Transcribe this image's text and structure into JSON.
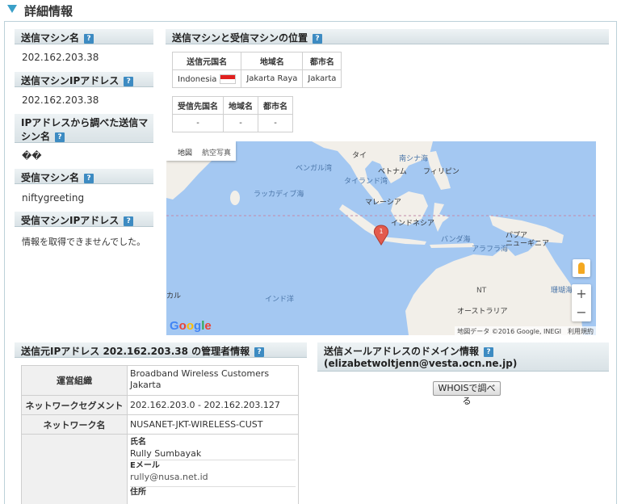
{
  "page_title": "詳細情報",
  "help_glyph": "?",
  "sender": {
    "name_header": "送信マシン名",
    "name_value": "202.162.203.38",
    "ip_header": "送信マシンIPアドレス",
    "ip_value": "202.162.203.38",
    "lookup_header": "IPアドレスから調べた送信マシン名",
    "lookup_value": "��"
  },
  "receiver": {
    "name_header": "受信マシン名",
    "name_value": "niftygreeting",
    "ip_header": "受信マシンIPアドレス",
    "ip_value": "情報を取得できませんでした。"
  },
  "location": {
    "header": "送信マシンと受信マシンの位置",
    "sender_table": {
      "headers": [
        "送信元国名",
        "地域名",
        "都市名"
      ],
      "country": "Indonesia",
      "region": "Jakarta Raya",
      "city": "Jakarta"
    },
    "receiver_table": {
      "headers": [
        "受信先国名",
        "地域名",
        "都市名"
      ],
      "values": [
        "-",
        "-",
        "-"
      ]
    }
  },
  "map": {
    "tab_map": "地図",
    "tab_satellite": "航空写真",
    "marker_label": "1",
    "logo": "Google",
    "attribution": "地図データ ©2016 Google, INEGI　利用規約",
    "zoom_in": "+",
    "zoom_out": "−",
    "labels": {
      "thai": "タイ",
      "south_china_sea": "南シナ海",
      "bengal": "ベンガル湾",
      "vietnam": "ベトナム",
      "philippines": "フィリピン",
      "gulf_thailand": "タイランド湾",
      "laccadive": "ラッカディブ海",
      "malaysia": "マレーシア",
      "indonesia": "インドネシア",
      "banda": "バンダ海",
      "arafura": "アラフラ海",
      "papua": "パプア\nニューギニア",
      "nt": "NT",
      "indian_ocean": "インド洋",
      "kal": "カル",
      "australia": "オーストラリア",
      "coral": "珊瑚海"
    }
  },
  "admin": {
    "header": "送信元IPアドレス 202.162.203.38 の管理者情報",
    "rows": [
      {
        "label": "運営組織",
        "value1": "Broadband Wireless Customers",
        "value2": "Jakarta"
      },
      {
        "label": "ネットワークセグメント",
        "value1": "202.162.203.0 - 202.162.203.127"
      },
      {
        "label": "ネットワーク名",
        "value1": "NUSANET-JKT-WIRELESS-CUST"
      }
    ],
    "contact": {
      "name_label": "氏名",
      "name_value": "Rully Sumbayak",
      "email_label": "Eメール",
      "email_value": "rully@nusa.net.id",
      "address_label": "住所"
    }
  },
  "domain": {
    "header": "送信メールアドレスのドメイン情報",
    "address": "(elizabetwoltjenn@vesta.ocn.ne.jp)",
    "whois_button": "WHOISで調べる"
  },
  "colors": {
    "accent": "#3aa0c8",
    "help": "#3d8bc2",
    "water": "#a4c8f2",
    "land": "#f2efe9",
    "flag_red": "#e0201f"
  }
}
